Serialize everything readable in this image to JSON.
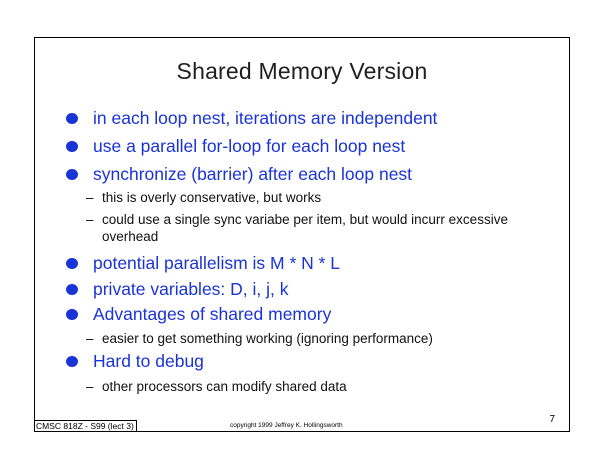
{
  "slide": {
    "title": "Shared Memory Version",
    "items": [
      {
        "level": 1,
        "text": "in each loop nest, iterations are independent"
      },
      {
        "level": 1,
        "text": "use a parallel for-loop for each loop nest"
      },
      {
        "level": 1,
        "text": "synchronize (barrier) after each loop nest"
      },
      {
        "level": 2,
        "text": "this is overly conservative, but works"
      },
      {
        "level": 2,
        "text": "could use a single sync variabe per item, but would incurr excessive overhead"
      },
      {
        "level": 1,
        "text": "potential parallelism is M * N * L"
      },
      {
        "level": 1,
        "text": "private variables: D, i, j, k"
      },
      {
        "level": 1,
        "text": "Advantages of shared memory"
      },
      {
        "level": 2,
        "text": "easier to get something working (ignoring performance)"
      },
      {
        "level": 1,
        "text": "Hard to debug"
      },
      {
        "level": 2,
        "text": "other processors can modify shared data"
      }
    ],
    "footer_left": "CMSC 818Z - S99  (lect 3)",
    "footer_center": "copyright 1999 Jeffrey K. Hollingsworth",
    "page_number": "7"
  },
  "colors": {
    "bullet_text": "#1a33d6",
    "sub_text": "#111111",
    "title": "#202020"
  }
}
